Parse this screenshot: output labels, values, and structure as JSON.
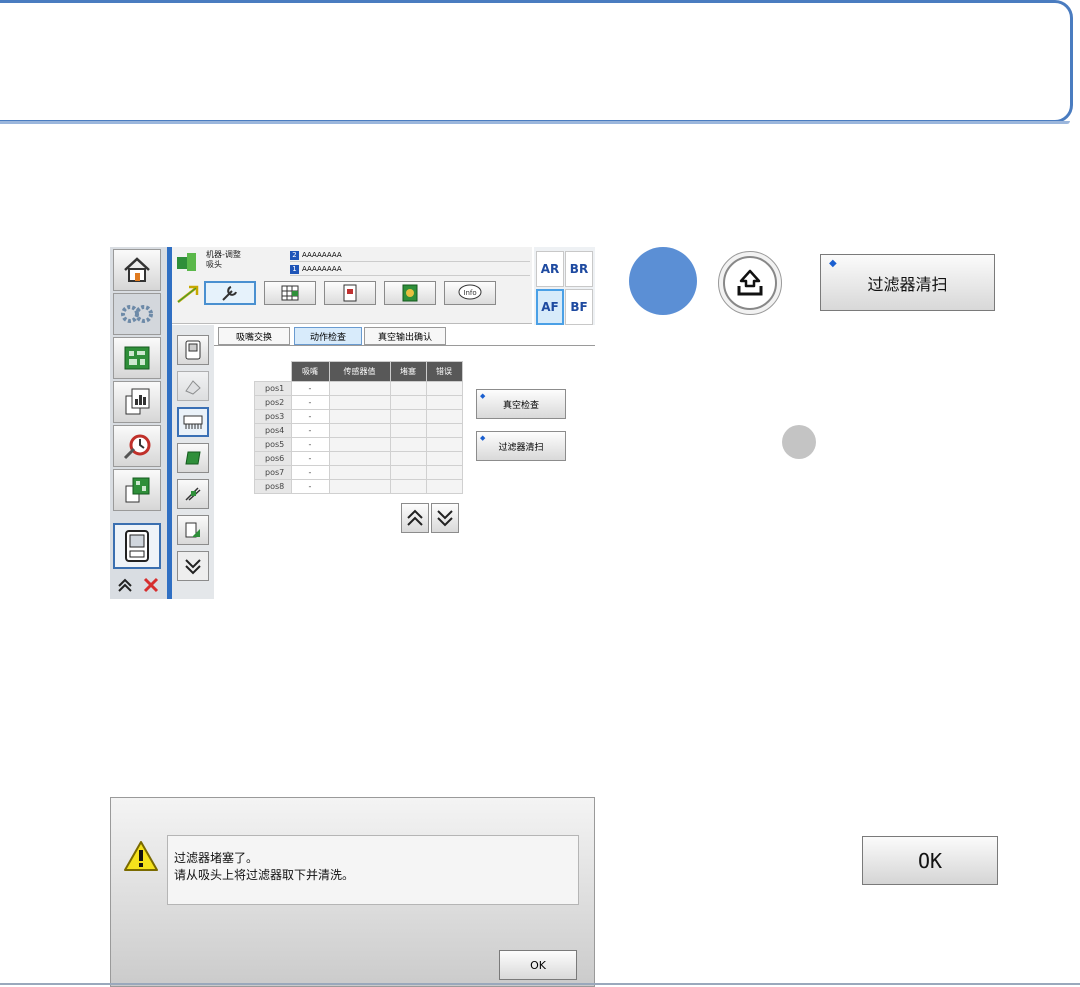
{
  "screen": {
    "title_line1": "机器-调整",
    "title_line2": "吸头",
    "field1": "AAAAAAAA",
    "field2": "AAAAAAAA",
    "field1_badge": "2",
    "field2_badge": "1",
    "lanes": [
      "AR",
      "BR",
      "AF",
      "BF"
    ],
    "info_label": "Info",
    "content_tabs": [
      "吸嘴交换",
      "动作检查",
      "真空输出确认"
    ],
    "table": {
      "headers": [
        "",
        "吸嘴",
        "传感器值",
        "堵塞",
        "错误"
      ],
      "rows": [
        {
          "label": "pos1",
          "nozzle": "-"
        },
        {
          "label": "pos2",
          "nozzle": "-"
        },
        {
          "label": "pos3",
          "nozzle": "-"
        },
        {
          "label": "pos4",
          "nozzle": "-"
        },
        {
          "label": "pos5",
          "nozzle": "-"
        },
        {
          "label": "pos6",
          "nozzle": "-"
        },
        {
          "label": "pos7",
          "nozzle": "-"
        },
        {
          "label": "pos8",
          "nozzle": "-"
        }
      ]
    },
    "vacuum_check_label": "真空检查",
    "filter_clean_label": "过滤器清扫"
  },
  "callouts": {
    "filter_clean_big_label": "过滤器清扫",
    "ok_big_label": "OK"
  },
  "dialog": {
    "message_line1": "过滤器堵塞了。",
    "message_line2": "请从吸头上将过滤器取下并清洗。",
    "ok_label": "OK"
  },
  "colors": {
    "accent_blue": "#2f6fc3",
    "callout_circle": "#5b8fd5",
    "lane_text": "#1e4aa0"
  }
}
